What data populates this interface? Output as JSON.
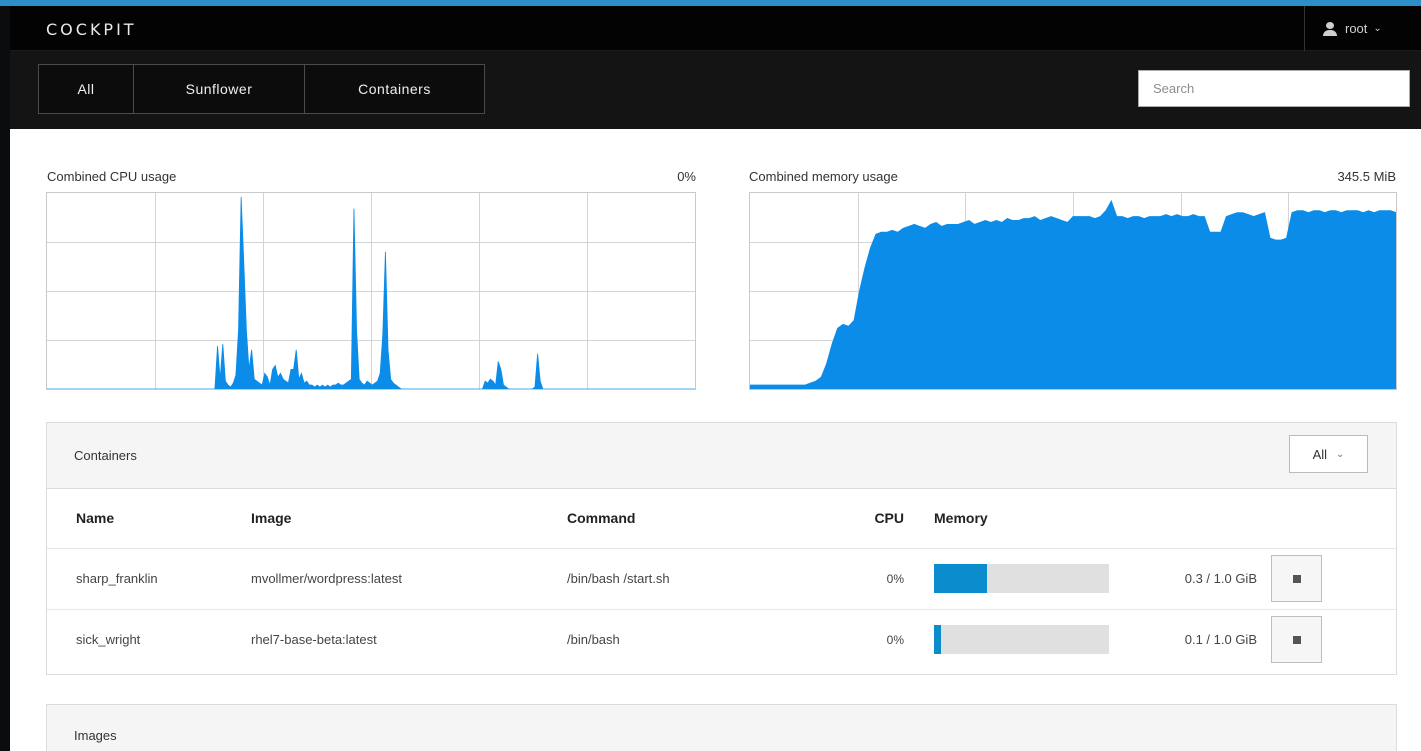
{
  "header": {
    "brand": "COCKPIT",
    "user": "root"
  },
  "nav": {
    "buttons": [
      "All",
      "Sunflower",
      "Containers"
    ],
    "search_placeholder": "Search"
  },
  "charts": {
    "cpu": {
      "label": "Combined CPU usage",
      "value": "0%"
    },
    "memory": {
      "label": "Combined memory usage",
      "value": "345.5 MiB"
    }
  },
  "chart_data": [
    {
      "type": "area",
      "title": "Combined CPU usage",
      "current": "0%",
      "xlabel": "",
      "ylabel": "",
      "grid": true,
      "ylim": [
        0,
        1
      ],
      "series": [
        {
          "values": [
            0,
            0,
            0,
            0,
            0,
            0,
            0,
            0,
            0,
            0,
            0,
            0,
            0,
            0,
            0,
            0,
            0,
            0,
            0,
            0,
            0,
            0,
            0,
            0,
            0,
            0,
            0,
            0,
            0,
            0,
            0,
            0,
            0,
            0,
            0,
            0,
            0,
            0,
            0,
            0,
            0,
            0,
            0,
            0,
            0,
            0,
            0,
            0,
            0,
            0,
            0,
            0,
            0,
            0,
            0,
            0,
            0,
            0,
            0,
            0,
            0,
            0,
            0,
            0,
            0,
            0.22,
            0.05,
            0.23,
            0.04,
            0.02,
            0.01,
            0.03,
            0.07,
            0.3,
            0.98,
            0.65,
            0.3,
            0.1,
            0.2,
            0.05,
            0.04,
            0.03,
            0.02,
            0.08,
            0.06,
            0.02,
            0.1,
            0.12,
            0.06,
            0.08,
            0.05,
            0.04,
            0.03,
            0.1,
            0.1,
            0.2,
            0.05,
            0.08,
            0.03,
            0.04,
            0.02,
            0.02,
            0.01,
            0.02,
            0.01,
            0.02,
            0.01,
            0.02,
            0.01,
            0.02,
            0.02,
            0.03,
            0.02,
            0.02,
            0.03,
            0.04,
            0.05,
            0.92,
            0.3,
            0.05,
            0.03,
            0.02,
            0.04,
            0.03,
            0.02,
            0.03,
            0.04,
            0.08,
            0.28,
            0.7,
            0.2,
            0.05,
            0.03,
            0.02,
            0.01,
            0,
            0,
            0,
            0,
            0,
            0,
            0,
            0,
            0,
            0,
            0,
            0,
            0,
            0,
            0,
            0,
            0,
            0,
            0,
            0,
            0,
            0,
            0,
            0,
            0,
            0,
            0,
            0,
            0,
            0,
            0,
            0,
            0.04,
            0.03,
            0.05,
            0.04,
            0.02,
            0.14,
            0.1,
            0.02,
            0.01,
            0,
            0,
            0,
            0,
            0,
            0,
            0,
            0,
            0,
            0,
            0.01,
            0.18,
            0.04,
            0,
            0,
            0,
            0,
            0,
            0,
            0,
            0,
            0,
            0,
            0,
            0,
            0,
            0,
            0,
            0,
            0,
            0,
            0,
            0,
            0,
            0,
            0,
            0,
            0,
            0,
            0,
            0,
            0,
            0,
            0,
            0,
            0,
            0,
            0,
            0,
            0,
            0,
            0,
            0,
            0,
            0,
            0,
            0,
            0,
            0,
            0,
            0,
            0,
            0,
            0,
            0,
            0,
            0,
            0,
            0,
            0,
            0,
            0
          ]
        }
      ]
    },
    {
      "type": "area",
      "title": "Combined memory usage",
      "current": "345.5 MiB",
      "xlabel": "",
      "ylabel": "",
      "grid": true,
      "ylim": [
        0,
        1
      ],
      "series": [
        {
          "values": [
            0.02,
            0.02,
            0.02,
            0.02,
            0.02,
            0.02,
            0.02,
            0.02,
            0.02,
            0.02,
            0.02,
            0.03,
            0.04,
            0.06,
            0.13,
            0.23,
            0.31,
            0.33,
            0.32,
            0.35,
            0.5,
            0.62,
            0.72,
            0.79,
            0.8,
            0.8,
            0.81,
            0.8,
            0.82,
            0.83,
            0.84,
            0.83,
            0.82,
            0.84,
            0.85,
            0.83,
            0.84,
            0.84,
            0.84,
            0.85,
            0.86,
            0.84,
            0.85,
            0.86,
            0.85,
            0.86,
            0.85,
            0.87,
            0.86,
            0.86,
            0.87,
            0.87,
            0.88,
            0.86,
            0.87,
            0.88,
            0.87,
            0.86,
            0.85,
            0.88,
            0.88,
            0.88,
            0.88,
            0.87,
            0.88,
            0.91,
            0.96,
            0.88,
            0.88,
            0.87,
            0.88,
            0.88,
            0.87,
            0.88,
            0.88,
            0.88,
            0.89,
            0.88,
            0.89,
            0.88,
            0.88,
            0.89,
            0.88,
            0.88,
            0.8,
            0.8,
            0.8,
            0.88,
            0.89,
            0.9,
            0.9,
            0.89,
            0.88,
            0.89,
            0.9,
            0.77,
            0.76,
            0.76,
            0.77,
            0.9,
            0.91,
            0.91,
            0.9,
            0.91,
            0.91,
            0.9,
            0.91,
            0.91,
            0.9,
            0.91,
            0.91,
            0.91,
            0.9,
            0.91,
            0.9,
            0.91,
            0.91,
            0.91,
            0.9
          ]
        }
      ]
    }
  ],
  "containers": {
    "title": "Containers",
    "filter": "All",
    "columns": [
      "Name",
      "Image",
      "Command",
      "CPU",
      "Memory"
    ],
    "rows": [
      {
        "name": "sharp_franklin",
        "image": "mvollmer/wordpress:latest",
        "command": "/bin/bash /start.sh",
        "cpu": "0%",
        "memory_fraction": 0.3,
        "memory_text": "0.3 / 1.0 GiB"
      },
      {
        "name": "sick_wright",
        "image": "rhel7-base-beta:latest",
        "command": "/bin/bash",
        "cpu": "0%",
        "memory_fraction": 0.04,
        "memory_text": "0.1 / 1.0 GiB"
      }
    ]
  },
  "images": {
    "title": "Images"
  }
}
